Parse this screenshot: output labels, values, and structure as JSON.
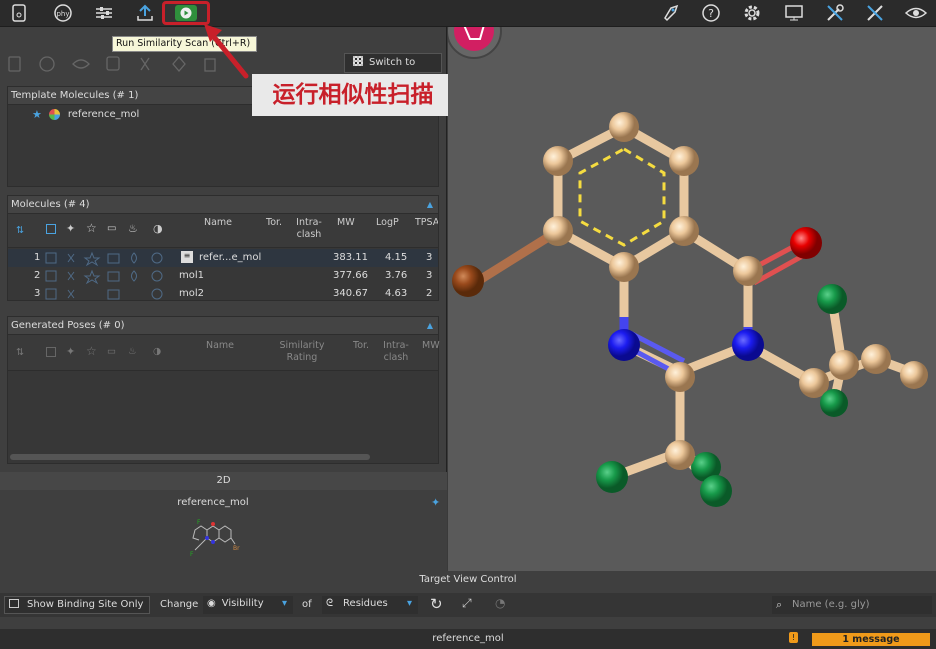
{
  "toolbar": {
    "tooltip": "Run Similarity Scan (Ctrl+R)",
    "switch_grid_label": "Switch to Grid",
    "annotation_label": "运行相似性扫描",
    "icons_left": [
      "file-icon",
      "phys-chem-icon",
      "sliders-icon",
      "upload-icon",
      "run-similarity-scan-icon"
    ],
    "icons_right": [
      "rocket-icon",
      "help-icon",
      "settings-icon",
      "monitor-icon",
      "tools-icon",
      "tools-alt-icon",
      "eye-settings-icon"
    ]
  },
  "template_panel": {
    "title": "Template Molecules (# 1)",
    "item": "reference_mol"
  },
  "molecules_panel": {
    "title": "Molecules (# 4)",
    "columns": [
      "Name",
      "Tor.",
      "Intra-\nclash",
      "MW",
      "LogP",
      "TPSA"
    ],
    "rows": [
      {
        "index": "1",
        "name": "refer...e_mol",
        "mw": "383.11",
        "logp": "4.15",
        "tpsa": "3"
      },
      {
        "index": "2",
        "name": "mol1",
        "mw": "377.66",
        "logp": "3.76",
        "tpsa": "3"
      },
      {
        "index": "3",
        "name": "mol2",
        "mw": "340.67",
        "logp": "4.63",
        "tpsa": "2"
      }
    ]
  },
  "poses_panel": {
    "title": "Generated Poses (# 0)",
    "columns": [
      "Name",
      "Similarity\nRating",
      "Tor.",
      "Intra-\nclash",
      "MW"
    ]
  },
  "view2d": {
    "header": "2D",
    "molecule_name": "reference_mol"
  },
  "target_view": {
    "title": "Target View Control",
    "show_binding_site": "Show Binding Site Only",
    "change_label": "Change",
    "visibility_label": "Visibility",
    "of_label": "of",
    "residues_label": "Residues",
    "name_placeholder": "Name (e.g. gly)"
  },
  "status": {
    "current_mol": "reference_mol",
    "message": "1 message"
  },
  "colors": {
    "accent_blue": "#4aa3e0",
    "highlight_red": "#c8202a",
    "message_orange": "#f09a1a",
    "logo_pink": "#d21f62"
  }
}
